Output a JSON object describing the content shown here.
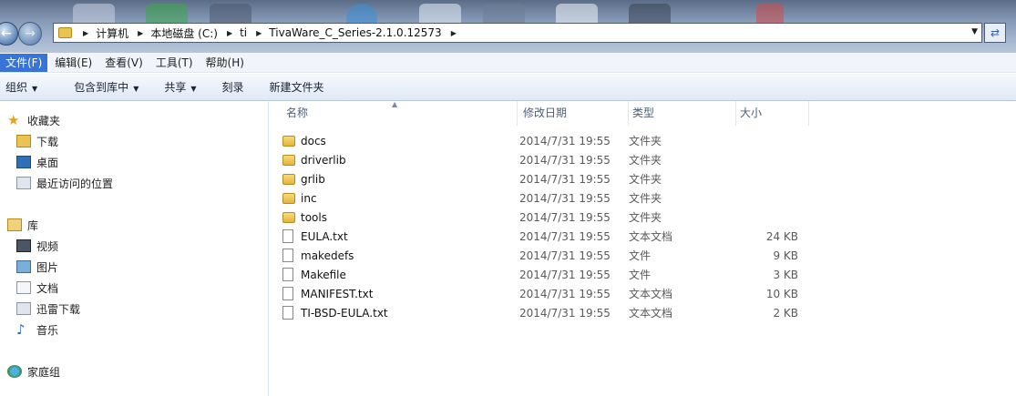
{
  "address": {
    "segments": [
      "计算机",
      "本地磁盘 (C:)",
      "ti",
      "TivaWare_C_Series-2.1.0.12573"
    ]
  },
  "menubar": [
    "文件(F)",
    "编辑(E)",
    "查看(V)",
    "工具(T)",
    "帮助(H)"
  ],
  "toolbar": {
    "organize": "组织",
    "include_library": "包含到库中",
    "share": "共享",
    "burn": "刻录",
    "new_folder": "新建文件夹"
  },
  "sidebar": {
    "favorites": {
      "label": "收藏夹",
      "items": [
        "下载",
        "桌面",
        "最近访问的位置"
      ]
    },
    "libraries": {
      "label": "库",
      "items": [
        "视频",
        "图片",
        "文档",
        "迅雷下载",
        "音乐"
      ]
    },
    "homegroup": {
      "label": "家庭组"
    }
  },
  "columns": {
    "name": "名称",
    "date": "修改日期",
    "type": "类型",
    "size": "大小"
  },
  "files": [
    {
      "name": "docs",
      "date": "2014/7/31 19:55",
      "type": "文件夹",
      "size": "",
      "kind": "folder"
    },
    {
      "name": "driverlib",
      "date": "2014/7/31 19:55",
      "type": "文件夹",
      "size": "",
      "kind": "folder"
    },
    {
      "name": "grlib",
      "date": "2014/7/31 19:55",
      "type": "文件夹",
      "size": "",
      "kind": "folder"
    },
    {
      "name": "inc",
      "date": "2014/7/31 19:55",
      "type": "文件夹",
      "size": "",
      "kind": "folder"
    },
    {
      "name": "tools",
      "date": "2014/7/31 19:55",
      "type": "文件夹",
      "size": "",
      "kind": "folder"
    },
    {
      "name": "EULA.txt",
      "date": "2014/7/31 19:55",
      "type": "文本文档",
      "size": "24 KB",
      "kind": "text"
    },
    {
      "name": "makedefs",
      "date": "2014/7/31 19:55",
      "type": "文件",
      "size": "9 KB",
      "kind": "file"
    },
    {
      "name": "Makefile",
      "date": "2014/7/31 19:55",
      "type": "文件",
      "size": "3 KB",
      "kind": "file"
    },
    {
      "name": "MANIFEST.txt",
      "date": "2014/7/31 19:55",
      "type": "文本文档",
      "size": "10 KB",
      "kind": "text"
    },
    {
      "name": "TI-BSD-EULA.txt",
      "date": "2014/7/31 19:55",
      "type": "文本文档",
      "size": "2 KB",
      "kind": "text"
    }
  ],
  "colors": {
    "menu_active": "#3874d8",
    "folder": "#e4b43c",
    "header_text": "#4c5f79"
  }
}
